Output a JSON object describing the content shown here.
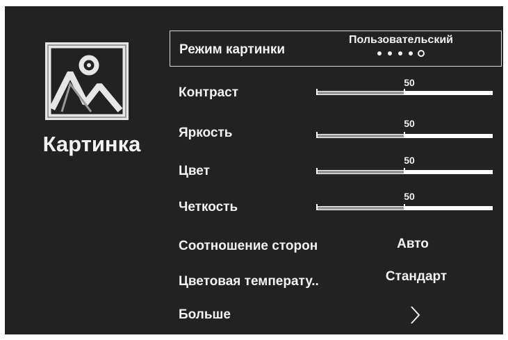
{
  "sidebar": {
    "icon": "picture-mountains-icon",
    "title": "Картинка"
  },
  "menu": {
    "picture_mode": {
      "label": "Режим картинки",
      "value": "Пользовательский",
      "options_count": 5,
      "selected_index": 4
    },
    "contrast": {
      "label": "Контраст",
      "value": "50",
      "level": 0.5
    },
    "brightness": {
      "label": "Яркость",
      "value": "50",
      "level": 0.5
    },
    "color": {
      "label": "Цвет",
      "value": "50",
      "level": 0.5
    },
    "sharpness": {
      "label": "Четкость",
      "value": "50",
      "level": 0.5
    },
    "aspect_ratio": {
      "label": "Соотношение сторон",
      "value": "Авто"
    },
    "color_temperature": {
      "label": "Цветовая температу..",
      "value": "Стандарт"
    },
    "more": {
      "label": "Больше",
      "icon": "chevron-right-icon"
    }
  },
  "colors": {
    "background": "#222222",
    "text": "#f2f2f2",
    "slider_fill": "#9a9a9a",
    "slider_track": "#ffffff"
  }
}
